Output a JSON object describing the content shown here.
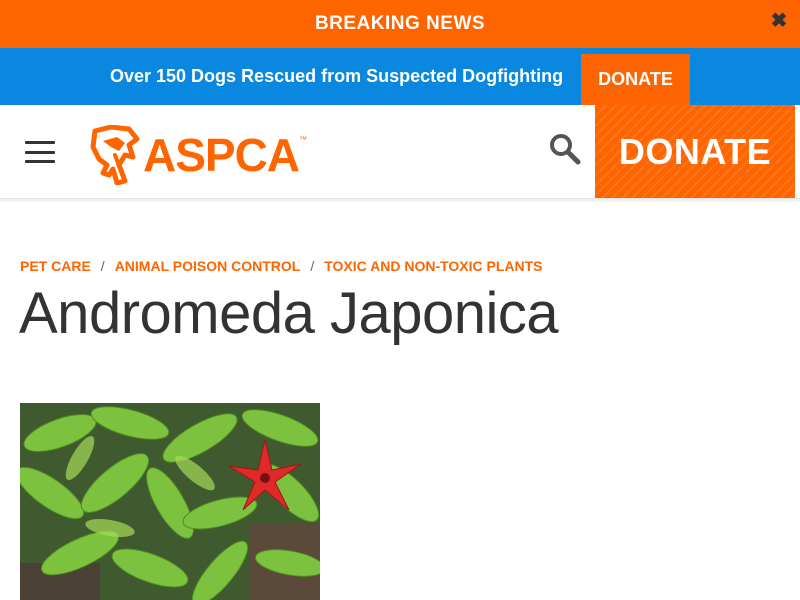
{
  "breaking": {
    "title": "BREAKING NEWS",
    "close_glyph": "✖"
  },
  "promo": {
    "text": "Over 150 Dogs Rescued from Suspected Dogfighting",
    "donate_label": "DONATE"
  },
  "header": {
    "logo_text": "ASPCA",
    "logo_tm": "™",
    "donate_label": "DONATE"
  },
  "breadcrumb": [
    {
      "label": "PET CARE"
    },
    {
      "label": "ANIMAL POISON CONTROL"
    },
    {
      "label": "TOXIC AND NON-TOXIC PLANTS"
    }
  ],
  "breadcrumb_sep": "/",
  "page": {
    "title": "Andromeda Japonica"
  },
  "colors": {
    "brand_orange": "#fe6400",
    "promo_blue": "#0a88e0",
    "text_dark": "#333333"
  },
  "icons": [
    "close-icon",
    "menu-icon",
    "aspca-logo-icon",
    "search-icon"
  ]
}
